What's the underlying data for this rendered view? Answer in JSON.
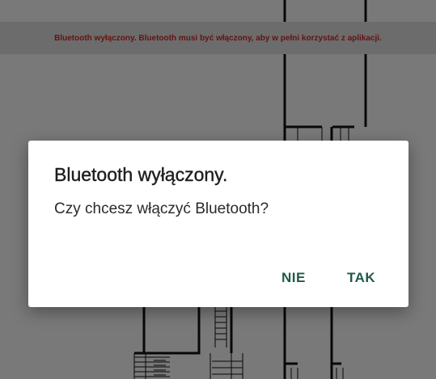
{
  "banner": {
    "message": "Bluetooth wyłączony. Bluetooth musi być włączony, aby w pełni korzystać z aplikacji."
  },
  "dialog": {
    "title": "Bluetooth wyłączony.",
    "message": "Czy chcesz włączyć Bluetooth?",
    "negative_label": "NIE",
    "positive_label": "TAK"
  },
  "colors": {
    "banner_text": "#c62828",
    "button_text": "#1e5a4a",
    "scrim": "rgba(0,0,0,0.5)"
  },
  "icons": {
    "background": "floor-plan-map"
  }
}
